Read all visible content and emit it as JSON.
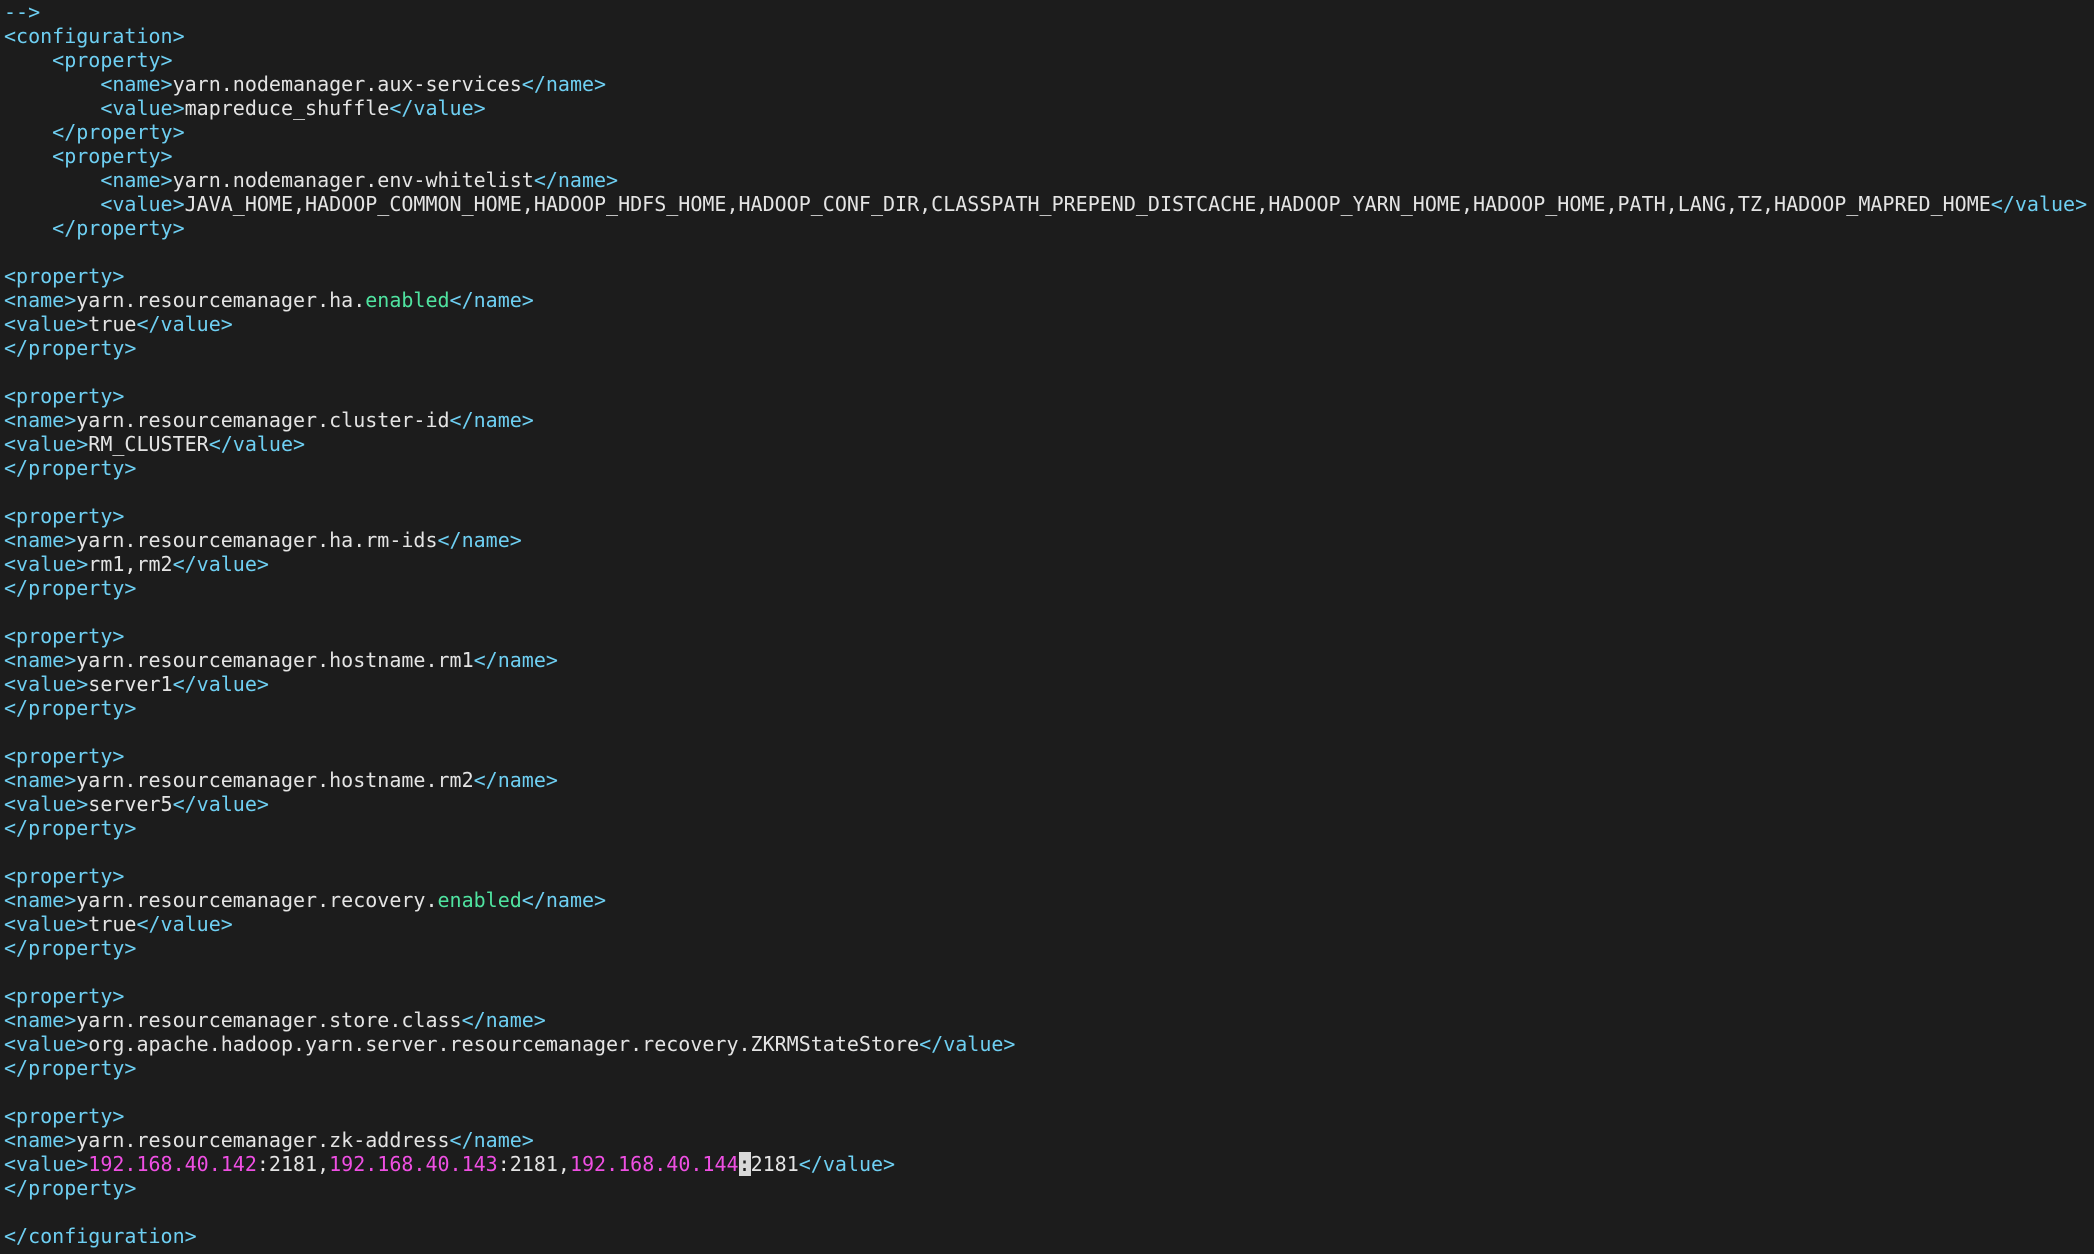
{
  "editor": {
    "theme": {
      "background": "#1c1c1c",
      "tag": "#6ecff2",
      "text": "#e4e4e4",
      "keyword": "#4fe3a0",
      "number": "#ef4fe3",
      "cursor": "#d8d8d8"
    },
    "lines": [
      [
        {
          "t": "-->",
          "c": "cmt"
        }
      ],
      [
        {
          "t": "<configuration>",
          "c": "tag"
        }
      ],
      [
        {
          "t": "    ",
          "c": "text"
        },
        {
          "t": "<property>",
          "c": "tag"
        }
      ],
      [
        {
          "t": "        ",
          "c": "text"
        },
        {
          "t": "<name>",
          "c": "tag"
        },
        {
          "t": "yarn.nodemanager.aux-services",
          "c": "text"
        },
        {
          "t": "</name>",
          "c": "tag"
        }
      ],
      [
        {
          "t": "        ",
          "c": "text"
        },
        {
          "t": "<value>",
          "c": "tag"
        },
        {
          "t": "mapreduce_shuffle",
          "c": "text"
        },
        {
          "t": "</value>",
          "c": "tag"
        }
      ],
      [
        {
          "t": "    ",
          "c": "text"
        },
        {
          "t": "</property>",
          "c": "tag"
        }
      ],
      [
        {
          "t": "    ",
          "c": "text"
        },
        {
          "t": "<property>",
          "c": "tag"
        }
      ],
      [
        {
          "t": "        ",
          "c": "text"
        },
        {
          "t": "<name>",
          "c": "tag"
        },
        {
          "t": "yarn.nodemanager.env-whitelist",
          "c": "text"
        },
        {
          "t": "</name>",
          "c": "tag"
        }
      ],
      [
        {
          "t": "        ",
          "c": "text"
        },
        {
          "t": "<value>",
          "c": "tag"
        },
        {
          "t": "JAVA_HOME,HADOOP_COMMON_HOME,HADOOP_HDFS_HOME,HADOOP_CONF_DIR,CLASSPATH_PREPEND_DISTCACHE,HADOOP_YARN_HOME,HADOOP_HOME,PATH,LANG,TZ,HADOOP_MAPRED_HOME",
          "c": "text"
        },
        {
          "t": "</value>",
          "c": "tag"
        }
      ],
      [
        {
          "t": "    ",
          "c": "text"
        },
        {
          "t": "</property>",
          "c": "tag"
        }
      ],
      [],
      [
        {
          "t": "<property>",
          "c": "tag"
        }
      ],
      [
        {
          "t": "<name>",
          "c": "tag"
        },
        {
          "t": "yarn.resourcemanager.ha.",
          "c": "text"
        },
        {
          "t": "enabled",
          "c": "kw"
        },
        {
          "t": "</name>",
          "c": "tag"
        }
      ],
      [
        {
          "t": "<value>",
          "c": "tag"
        },
        {
          "t": "true",
          "c": "text"
        },
        {
          "t": "</value>",
          "c": "tag"
        }
      ],
      [
        {
          "t": "</property>",
          "c": "tag"
        }
      ],
      [],
      [
        {
          "t": "<property>",
          "c": "tag"
        }
      ],
      [
        {
          "t": "<name>",
          "c": "tag"
        },
        {
          "t": "yarn.resourcemanager.cluster-id",
          "c": "text"
        },
        {
          "t": "</name>",
          "c": "tag"
        }
      ],
      [
        {
          "t": "<value>",
          "c": "tag"
        },
        {
          "t": "RM_CLUSTER",
          "c": "text"
        },
        {
          "t": "</value>",
          "c": "tag"
        }
      ],
      [
        {
          "t": "</property>",
          "c": "tag"
        }
      ],
      [],
      [
        {
          "t": "<property>",
          "c": "tag"
        }
      ],
      [
        {
          "t": "<name>",
          "c": "tag"
        },
        {
          "t": "yarn.resourcemanager.ha.rm-ids",
          "c": "text"
        },
        {
          "t": "</name>",
          "c": "tag"
        }
      ],
      [
        {
          "t": "<value>",
          "c": "tag"
        },
        {
          "t": "rm1,rm2",
          "c": "text"
        },
        {
          "t": "</value>",
          "c": "tag"
        }
      ],
      [
        {
          "t": "</property>",
          "c": "tag"
        }
      ],
      [],
      [
        {
          "t": "<property>",
          "c": "tag"
        }
      ],
      [
        {
          "t": "<name>",
          "c": "tag"
        },
        {
          "t": "yarn.resourcemanager.hostname.rm1",
          "c": "text"
        },
        {
          "t": "</name>",
          "c": "tag"
        }
      ],
      [
        {
          "t": "<value>",
          "c": "tag"
        },
        {
          "t": "server1",
          "c": "text"
        },
        {
          "t": "</value>",
          "c": "tag"
        }
      ],
      [
        {
          "t": "</property>",
          "c": "tag"
        }
      ],
      [],
      [
        {
          "t": "<property>",
          "c": "tag"
        }
      ],
      [
        {
          "t": "<name>",
          "c": "tag"
        },
        {
          "t": "yarn.resourcemanager.hostname.rm2",
          "c": "text"
        },
        {
          "t": "</name>",
          "c": "tag"
        }
      ],
      [
        {
          "t": "<value>",
          "c": "tag"
        },
        {
          "t": "server5",
          "c": "text"
        },
        {
          "t": "</value>",
          "c": "tag"
        }
      ],
      [
        {
          "t": "</property>",
          "c": "tag"
        }
      ],
      [],
      [
        {
          "t": "<property>",
          "c": "tag"
        }
      ],
      [
        {
          "t": "<name>",
          "c": "tag"
        },
        {
          "t": "yarn.resourcemanager.recovery.",
          "c": "text"
        },
        {
          "t": "enabled",
          "c": "kw"
        },
        {
          "t": "</name>",
          "c": "tag"
        }
      ],
      [
        {
          "t": "<value>",
          "c": "tag"
        },
        {
          "t": "true",
          "c": "text"
        },
        {
          "t": "</value>",
          "c": "tag"
        }
      ],
      [
        {
          "t": "</property>",
          "c": "tag"
        }
      ],
      [],
      [
        {
          "t": "<property>",
          "c": "tag"
        }
      ],
      [
        {
          "t": "<name>",
          "c": "tag"
        },
        {
          "t": "yarn.resourcemanager.store.class",
          "c": "text"
        },
        {
          "t": "</name>",
          "c": "tag"
        }
      ],
      [
        {
          "t": "<value>",
          "c": "tag"
        },
        {
          "t": "org.apache.hadoop.yarn.server.resourcemanager.recovery.ZKRMStateStore",
          "c": "text"
        },
        {
          "t": "</value>",
          "c": "tag"
        }
      ],
      [
        {
          "t": "</property>",
          "c": "tag"
        }
      ],
      [],
      [
        {
          "t": "<property>",
          "c": "tag"
        }
      ],
      [
        {
          "t": "<name>",
          "c": "tag"
        },
        {
          "t": "yarn.resourcemanager.zk-address",
          "c": "text"
        },
        {
          "t": "</name>",
          "c": "tag"
        }
      ],
      [
        {
          "t": "<value>",
          "c": "tag"
        },
        {
          "t": "192.168.40.142",
          "c": "num"
        },
        {
          "t": ":2181,",
          "c": "text"
        },
        {
          "t": "192.168.40.143",
          "c": "num"
        },
        {
          "t": ":2181,",
          "c": "text"
        },
        {
          "t": "192.168.40.144",
          "c": "num"
        },
        {
          "t": ":",
          "c": "cursor"
        },
        {
          "t": "2181",
          "c": "text"
        },
        {
          "t": "</value>",
          "c": "tag"
        }
      ],
      [
        {
          "t": "</property>",
          "c": "tag"
        }
      ],
      [],
      [
        {
          "t": "</configuration>",
          "c": "tag"
        }
      ]
    ]
  }
}
